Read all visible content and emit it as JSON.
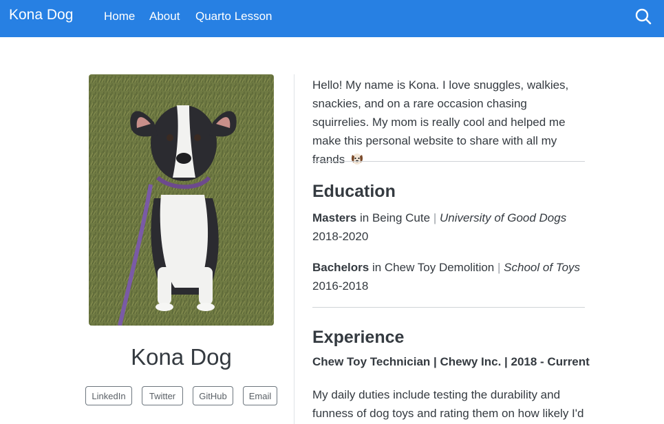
{
  "navbar": {
    "brand": "Kona Dog",
    "items": [
      {
        "label": "Home"
      },
      {
        "label": "About"
      },
      {
        "label": "Quarto Lesson"
      }
    ],
    "search_icon": "search-icon",
    "background_color": "#2780e3"
  },
  "profile": {
    "name": "Kona Dog",
    "links": [
      {
        "label": "LinkedIn"
      },
      {
        "label": "Twitter"
      },
      {
        "label": "GitHub"
      },
      {
        "label": "Email"
      }
    ]
  },
  "about": {
    "intro": "Hello! My name is Kona. I love snuggles, walkies, snackies, and on a rare occasion chasing squirrelies. My mom is really cool and helped me make this personal website to share with all my frands",
    "emoji_icon": "dog-face-icon"
  },
  "education": {
    "heading": "Education",
    "entries": [
      {
        "degree": "Masters",
        "field": "in Being Cute",
        "separator": "|",
        "school": "University of Good Dogs",
        "years": "2018-2020"
      },
      {
        "degree": "Bachelors",
        "field": "in Chew Toy Demolition",
        "separator": "|",
        "school": "School of Toys",
        "years": "2016-2018"
      }
    ]
  },
  "experience": {
    "heading": "Experience",
    "job_title": "Chew Toy Technician | Chewy Inc. | 2018 - Current",
    "description": "My daily duties include testing the durability and funness of dog toys and rating them on how likely I'd"
  }
}
